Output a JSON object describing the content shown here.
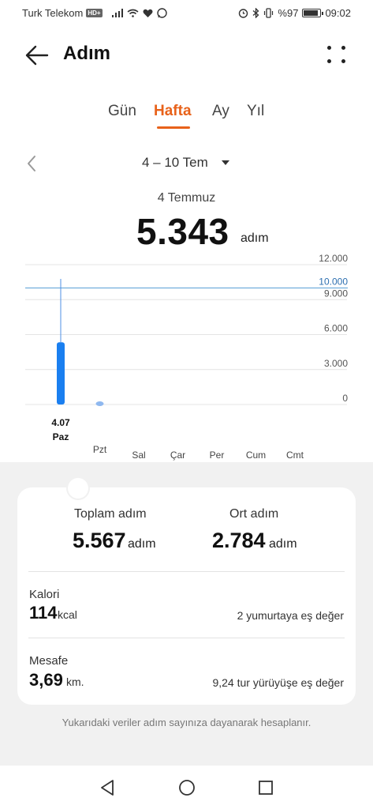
{
  "status_bar": {
    "carrier": "Turk Telekom",
    "network_badge": "HD+",
    "left_icons": [
      "signal-icon",
      "wifi-icon",
      "heart-icon",
      "whatsapp-icon"
    ],
    "right_icons": [
      "alarm-icon",
      "bluetooth-icon",
      "vibrate-icon"
    ],
    "battery_text": "%97",
    "time": "09:02"
  },
  "header": {
    "title": "Adım",
    "back_icon": "arrow-left-icon",
    "menu_icon": "more-dots-icon"
  },
  "tabs": [
    {
      "label": "Gün",
      "active": false
    },
    {
      "label": "Hafta",
      "active": true
    },
    {
      "label": "Ay",
      "active": false
    },
    {
      "label": "Yıl",
      "active": false
    }
  ],
  "accent_color": "#e8621a",
  "date_range": {
    "label": "4 – 10 Tem",
    "caret_icon": "caret-down-icon",
    "prev_icon": "chevron-left-icon"
  },
  "selection": {
    "date": "4 Temmuz",
    "steps": "5.343",
    "unit": "adım"
  },
  "chart_data": {
    "type": "bar",
    "categories": [
      "Paz",
      "Pzt",
      "Sal",
      "Çar",
      "Per",
      "Cum",
      "Cmt"
    ],
    "values": [
      5343,
      224,
      0,
      0,
      0,
      0,
      0
    ],
    "selected_index": 0,
    "selected_date_label": "4.07",
    "ylim": [
      0,
      12000
    ],
    "y_ticks": [
      "0",
      "3.000",
      "6.000",
      "9.000",
      "12.000"
    ],
    "y_tick_values": [
      0,
      3000,
      6000,
      9000,
      12000
    ],
    "goal_value": 10000,
    "goal_label": "10.000",
    "bar_color": "#1a7ff0",
    "goal_color": "#5aa0d6",
    "grid": true
  },
  "summary": {
    "total_label": "Toplam adım",
    "total_value": "5.567",
    "total_unit": "adım",
    "avg_label": "Ort adım",
    "avg_value": "2.784",
    "avg_unit": "adım"
  },
  "calories": {
    "label": "Kalori",
    "value": "114",
    "unit": "kcal",
    "note": "2 yumurtaya eş değer"
  },
  "distance": {
    "label": "Mesafe",
    "value": "3,69",
    "unit": "km.",
    "note": "9,24 tur yürüyüşe eş değer"
  },
  "footnote": "Yukarıdaki veriler adım sayınıza dayanarak hesaplanır.",
  "nav": {
    "back_icon": "nav-back-icon",
    "home_icon": "nav-home-icon",
    "recents_icon": "nav-recents-icon"
  }
}
